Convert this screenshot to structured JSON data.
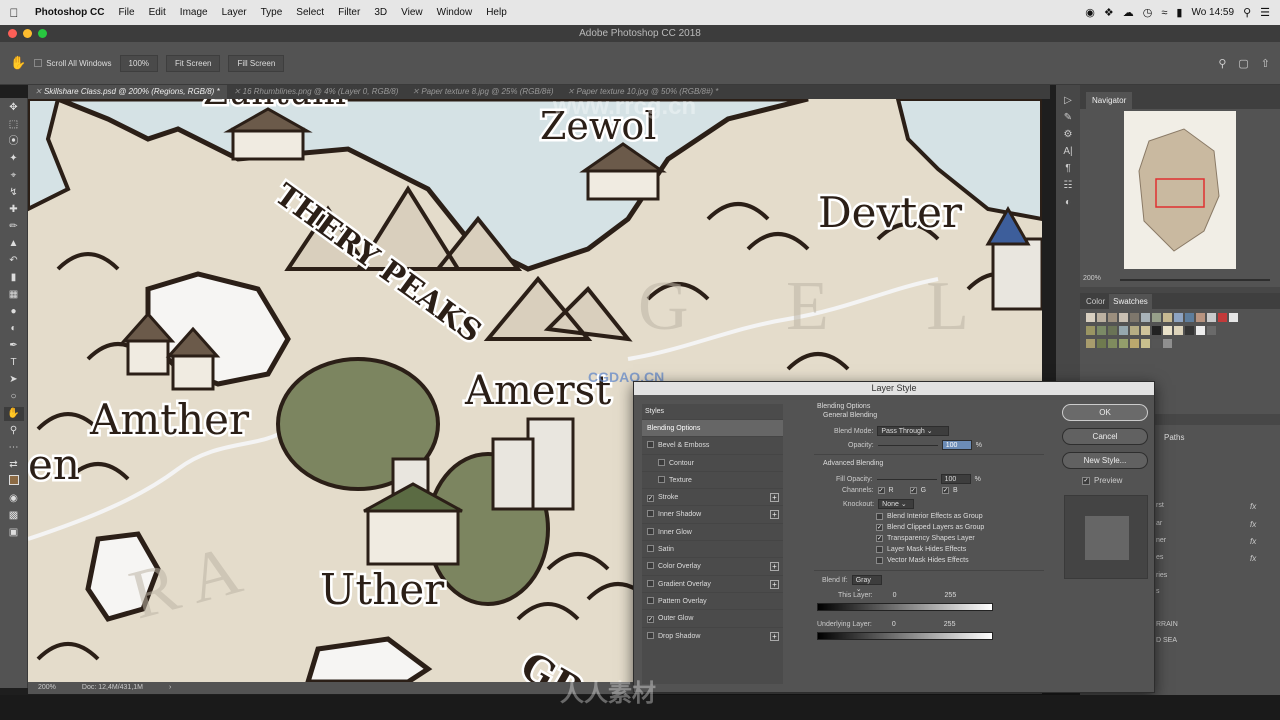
{
  "menubar": {
    "apple": "",
    "app_name": "Photoshop CC",
    "items": [
      "File",
      "Edit",
      "Image",
      "Layer",
      "Type",
      "Select",
      "Filter",
      "3D",
      "View",
      "Window",
      "Help"
    ],
    "clock": "Wo 14:59"
  },
  "window_title": "Adobe Photoshop CC 2018",
  "options_bar": {
    "scroll_all_windows": "Scroll All Windows",
    "zoom_100": "100%",
    "fit_screen": "Fit Screen",
    "fill_screen": "Fill Screen"
  },
  "doc_tabs": [
    "Skillshare Class.psd @ 200% (Regions, RGB/8) *",
    "16 Rhumblines.png @ 4% (Layer 0, RGB/8)",
    "Paper texture 8.jpg @ 25% (RGB/8#)",
    "Paper texture 10.jpg @ 50% (RGB/8#) *"
  ],
  "map_labels": {
    "top_cut": "Zuntum",
    "zewol": "Zewol",
    "devter": "Devter",
    "thery_peaks": "THERY PEAKS",
    "amerst": "Amerst",
    "amther": "Amther",
    "uther": "Uther",
    "en": "en",
    "gr": "GR",
    "geli": "G E L I",
    "ra": "R A"
  },
  "status": {
    "zoom": "200%",
    "doc": "Doc: 12,4M/431,1M"
  },
  "navigator": {
    "tab": "Navigator",
    "zoom": "200%"
  },
  "swatches": {
    "tab_color": "Color",
    "tab_swatches": "Swatches"
  },
  "layers": {
    "paths_tab": "Paths",
    "rows": [
      "rst",
      "ar",
      "ner",
      "es",
      "ries",
      "s",
      "RRAIN",
      "D SEA"
    ],
    "fx": "fx"
  },
  "dialog": {
    "title": "Layer Style",
    "styles_header": "Styles",
    "styles": [
      {
        "label": "Blending Options",
        "checked": null,
        "plus": false,
        "sub": false,
        "selected": true
      },
      {
        "label": "Bevel & Emboss",
        "checked": false,
        "plus": false,
        "sub": false
      },
      {
        "label": "Contour",
        "checked": false,
        "plus": false,
        "sub": true
      },
      {
        "label": "Texture",
        "checked": false,
        "plus": false,
        "sub": true
      },
      {
        "label": "Stroke",
        "checked": true,
        "plus": true,
        "sub": false
      },
      {
        "label": "Inner Shadow",
        "checked": false,
        "plus": true,
        "sub": false
      },
      {
        "label": "Inner Glow",
        "checked": false,
        "plus": false,
        "sub": false
      },
      {
        "label": "Satin",
        "checked": false,
        "plus": false,
        "sub": false
      },
      {
        "label": "Color Overlay",
        "checked": false,
        "plus": true,
        "sub": false
      },
      {
        "label": "Gradient Overlay",
        "checked": false,
        "plus": true,
        "sub": false
      },
      {
        "label": "Pattern Overlay",
        "checked": false,
        "plus": false,
        "sub": false
      },
      {
        "label": "Outer Glow",
        "checked": true,
        "plus": false,
        "sub": false
      },
      {
        "label": "Drop Shadow",
        "checked": false,
        "plus": true,
        "sub": false
      }
    ],
    "blending_options": "Blending Options",
    "general_blending": "General Blending",
    "blend_mode_label": "Blend Mode:",
    "blend_mode_value": "Pass Through",
    "opacity_label": "Opacity:",
    "opacity_value": "100",
    "percent": "%",
    "advanced_blending": "Advanced Blending",
    "fill_opacity_label": "Fill Opacity:",
    "fill_opacity_value": "100",
    "channels_label": "Channels:",
    "ch_r": "R",
    "ch_g": "G",
    "ch_b": "B",
    "knockout_label": "Knockout:",
    "knockout_value": "None",
    "adv_checks": [
      {
        "label": "Blend Interior Effects as Group",
        "checked": false
      },
      {
        "label": "Blend Clipped Layers as Group",
        "checked": true
      },
      {
        "label": "Transparency Shapes Layer",
        "checked": true
      },
      {
        "label": "Layer Mask Hides Effects",
        "checked": false
      },
      {
        "label": "Vector Mask Hides Effects",
        "checked": false
      }
    ],
    "blend_if_label": "Blend If:",
    "blend_if_value": "Gray",
    "this_layer_label": "This Layer:",
    "underlying_label": "Underlying Layer:",
    "range_min": "0",
    "range_max": "255",
    "ok": "OK",
    "cancel": "Cancel",
    "new_style": "New Style...",
    "preview": "Preview"
  },
  "watermarks": {
    "top": "www.rrcg.cn",
    "center": "CGDAO.CN",
    "bottom": "人人素材"
  },
  "colors": {
    "accent": "#6c8cb6",
    "map_paper": "#e4dccb",
    "ink": "#2b1f17",
    "water": "#d7e4e6"
  }
}
